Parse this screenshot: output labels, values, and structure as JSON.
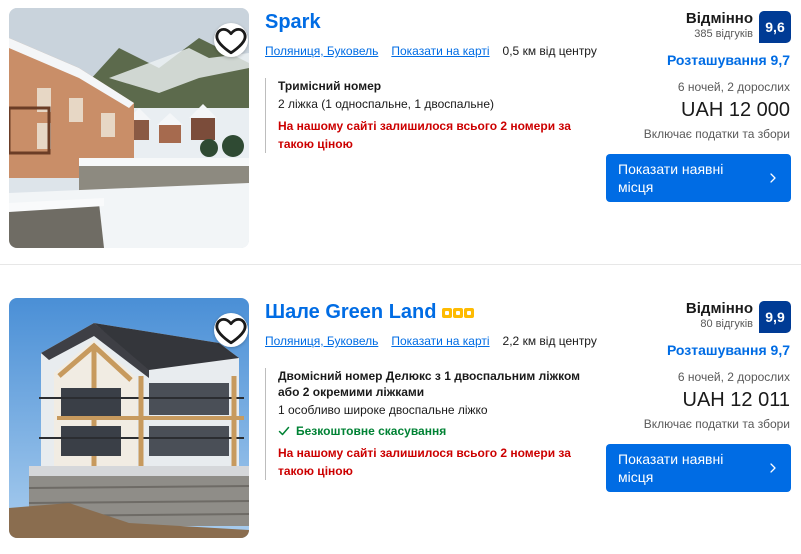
{
  "hotels": [
    {
      "name": "Spark",
      "has_stars": false,
      "location": "Поляниця, Буковель",
      "map_link": "Показати на карті",
      "distance": "0,5 км від центру",
      "room_name": "Тримісний номер",
      "beds": "2 ліжка (1 односпальне, 1 двоспальне)",
      "free_cancellation": "",
      "scarcity": "На нашому сайті залишилося всього 2 номери за такою ціною",
      "review_label": "Відмінно",
      "review_count": "385 відгуків",
      "score": "9,6",
      "location_score": "Розташування 9,7",
      "nights": "6 ночей, 2 дорослих",
      "price": "UAH 12 000",
      "taxes": "Включає податки та збори",
      "cta": "Показати наявні місця"
    },
    {
      "name": "Шале Green Land",
      "has_stars": true,
      "star_count": 3,
      "location": "Поляниця, Буковель",
      "map_link": "Показати на карті",
      "distance": "2,2 км від центру",
      "room_name": "Двомісний номер Делюкс з 1 двоспальним ліжком або 2 окремими ліжками",
      "beds": "1 особливо широке двоспальне ліжко",
      "free_cancellation": "Безкоштовне скасування",
      "scarcity": "На нашому сайті залишилося всього 2 номери за такою ціною",
      "review_label": "Відмінно",
      "review_count": "80 відгуків",
      "score": "9,9",
      "location_score": "Розташування 9,7",
      "nights": "6 ночей, 2 дорослих",
      "price": "UAH 12 011",
      "taxes": "Включає податки та збори",
      "cta": "Показати наявні місця"
    }
  ],
  "icons": {
    "favorite": "heart-outline-icon",
    "chevron": "chevron-right-icon",
    "check": "checkmark-icon",
    "stars": "star-rating-icon"
  },
  "colors": {
    "link": "#006ce4",
    "score_bg": "#003b95",
    "scarcity": "#cc0000",
    "free_cancel": "#008234",
    "star": "#febb02"
  }
}
